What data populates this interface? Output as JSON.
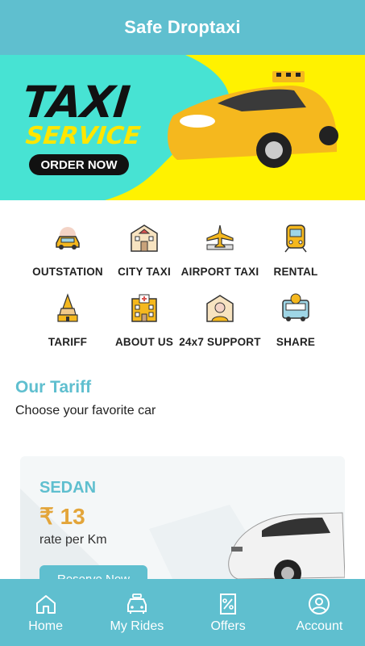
{
  "app": {
    "title": "Safe Droptaxi"
  },
  "banner": {
    "line1": "TAXI",
    "line2": "SERVICE",
    "cta": "ORDER NOW"
  },
  "categories": [
    {
      "label": "OUTSTATION",
      "icon": "outstation-car-icon"
    },
    {
      "label": "CITY TAXI",
      "icon": "city-building-icon"
    },
    {
      "label": "AIRPORT TAXI",
      "icon": "airplane-icon"
    },
    {
      "label": "RENTAL",
      "icon": "train-icon"
    },
    {
      "label": "TARIFF",
      "icon": "temple-icon"
    },
    {
      "label": "ABOUT US",
      "icon": "hospital-building-icon"
    },
    {
      "label": "24x7 SUPPORT",
      "icon": "support-agent-icon"
    },
    {
      "label": "SHARE",
      "icon": "share-bus-icon"
    }
  ],
  "tariff_section": {
    "title": "Our Tariff",
    "subtitle": "Choose your favorite car"
  },
  "tariff_card": {
    "name": "SEDAN",
    "price": "₹ 13",
    "unit": "rate per Km",
    "button": "Reserve Now"
  },
  "bottom_nav": [
    {
      "label": "Home",
      "icon": "home-icon"
    },
    {
      "label": "My Rides",
      "icon": "car-icon"
    },
    {
      "label": "Offers",
      "icon": "percent-icon"
    },
    {
      "label": "Account",
      "icon": "user-icon"
    }
  ],
  "colors": {
    "primary": "#5fbfcf",
    "banner_bg": "#47e3d3",
    "banner_yellow": "#fff200",
    "price": "#e3a53a"
  }
}
